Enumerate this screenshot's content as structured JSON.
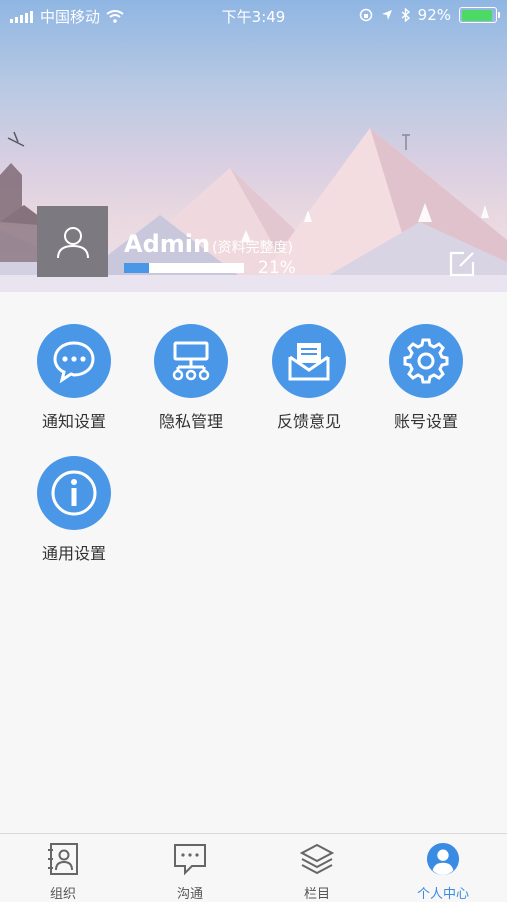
{
  "status_bar": {
    "carrier": "中国移动",
    "time": "下午3:49",
    "battery_percent": "92%",
    "battery_level": 0.92
  },
  "profile": {
    "username": "Admin",
    "completeness_label": "(资料完整度)",
    "completeness_percent": "21%",
    "completeness_value": 0.21
  },
  "menu": {
    "items": [
      {
        "label": "通知设置",
        "icon": "chat-bubble-icon"
      },
      {
        "label": "隐私管理",
        "icon": "hierarchy-icon"
      },
      {
        "label": "反馈意见",
        "icon": "mail-icon"
      },
      {
        "label": "账号设置",
        "icon": "gear-icon"
      },
      {
        "label": "通用设置",
        "icon": "info-icon"
      }
    ]
  },
  "tab_bar": {
    "tabs": [
      {
        "label": "组织",
        "icon": "contact-book-icon",
        "active": false
      },
      {
        "label": "沟通",
        "icon": "chat-icon",
        "active": false
      },
      {
        "label": "栏目",
        "icon": "layers-icon",
        "active": false
      },
      {
        "label": "个人中心",
        "icon": "user-icon",
        "active": true
      }
    ]
  },
  "colors": {
    "accent": "#4a97e8",
    "active_tab": "#3a8be3",
    "battery_green": "#4cd964"
  }
}
